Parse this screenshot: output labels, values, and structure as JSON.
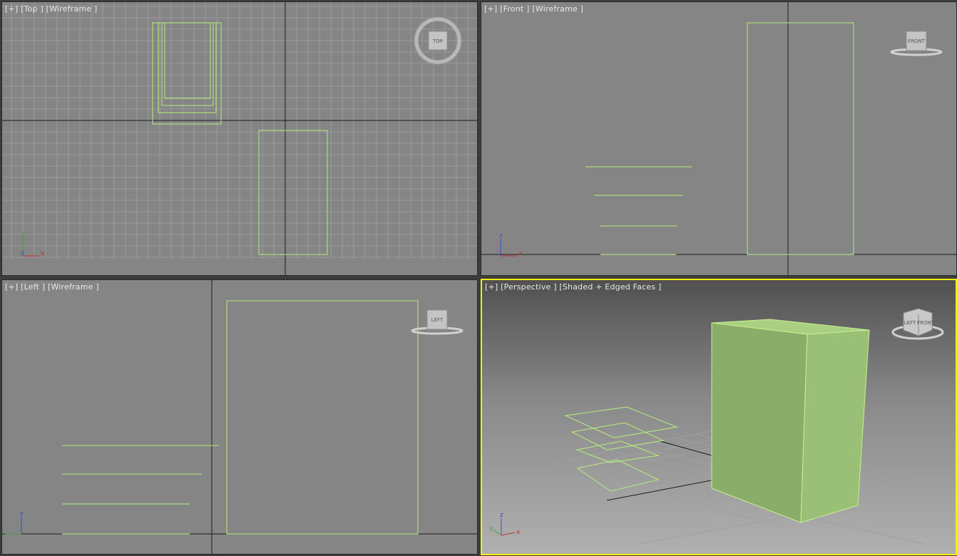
{
  "viewports": {
    "top": {
      "label": "[+] [Top ] [Wireframe ]",
      "nav": "TOP",
      "axis_a": "y",
      "axis_b": "x",
      "axis_c": "z"
    },
    "front": {
      "label": "[+] [Front ] [Wireframe ]",
      "nav": "FRONT",
      "axis_a": "z",
      "axis_b": "x"
    },
    "left": {
      "label": "[+] [Left ] [Wireframe ]",
      "nav": "LEFT",
      "axis_a": "z",
      "axis_b": "y"
    },
    "persp": {
      "label": "[+] [Perspective ] [Shaded + Edged Faces ]",
      "nav_a": "LEFT",
      "nav_b": "FRONT",
      "axis_a": "z",
      "axis_b": "x",
      "axis_c": "y"
    }
  },
  "colors": {
    "wire": "#b4f07a",
    "grid": "#9a9a9a",
    "active_border": "#f2f20a",
    "box_front": "#8aad6a",
    "box_side": "#9abf76",
    "box_top": "#a9cf82"
  }
}
